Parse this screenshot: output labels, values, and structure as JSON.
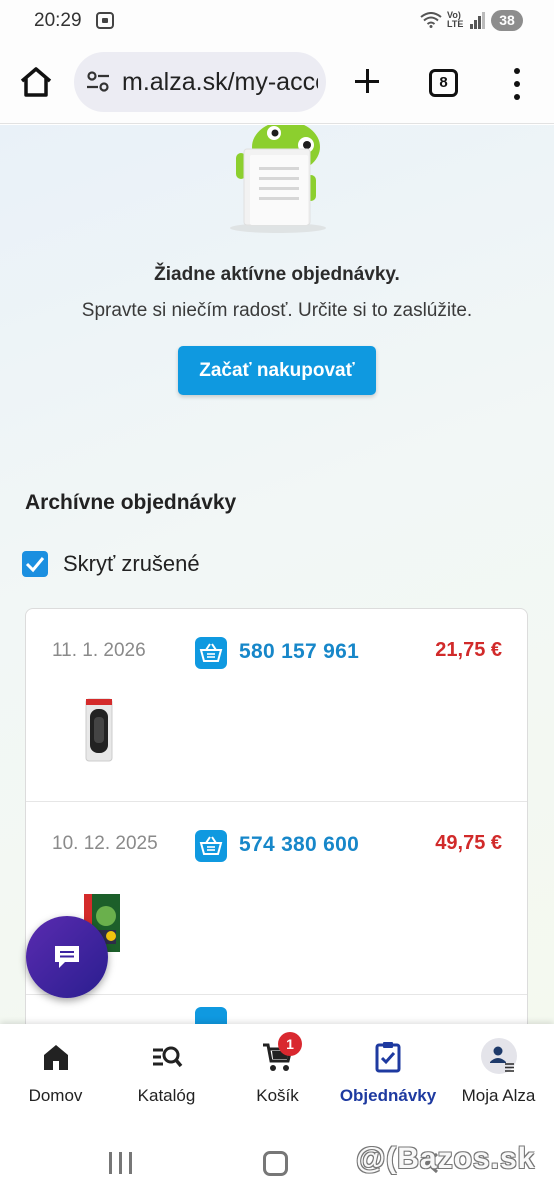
{
  "status_bar": {
    "time": "20:29",
    "volte": "Vo)) LTE",
    "battery": "38"
  },
  "browser": {
    "url": "m.alza.sk/my-account",
    "tab_count": "8"
  },
  "empty_state": {
    "title": "Žiadne aktívne objednávky.",
    "subtitle": "Spravte si niečím radosť. Určite si to zaslúžite.",
    "button": "Začať nakupovať"
  },
  "archive": {
    "title": "Archívne objednávky",
    "hide_cancelled_label": "Skryť zrušené",
    "hide_cancelled_checked": true,
    "orders": [
      {
        "date": "11. 1. 2026",
        "number": "580 157 961",
        "price": "21,75 €",
        "thumb": "black-controller-case"
      },
      {
        "date": "10. 12. 2025",
        "number": "574 380 600",
        "price": "49,75 €",
        "thumb": "luigis-mansion-3-game"
      }
    ]
  },
  "bottom_nav": {
    "items": [
      {
        "label": "Domov",
        "icon": "home-icon"
      },
      {
        "label": "Katalóg",
        "icon": "catalog-search-icon"
      },
      {
        "label": "Košík",
        "icon": "cart-icon",
        "badge": "1"
      },
      {
        "label": "Objednávky",
        "icon": "orders-clipboard-icon",
        "active": true
      },
      {
        "label": "Moja Alza",
        "icon": "user-avatar-icon"
      }
    ]
  },
  "watermark": "@(Bazos.sk",
  "colors": {
    "accent_blue": "#0f99e0",
    "order_number_blue": "#1787c9",
    "price_red": "#d12a2a",
    "active_nav": "#1e3aa0",
    "chat_purple": "#3b22a0"
  }
}
